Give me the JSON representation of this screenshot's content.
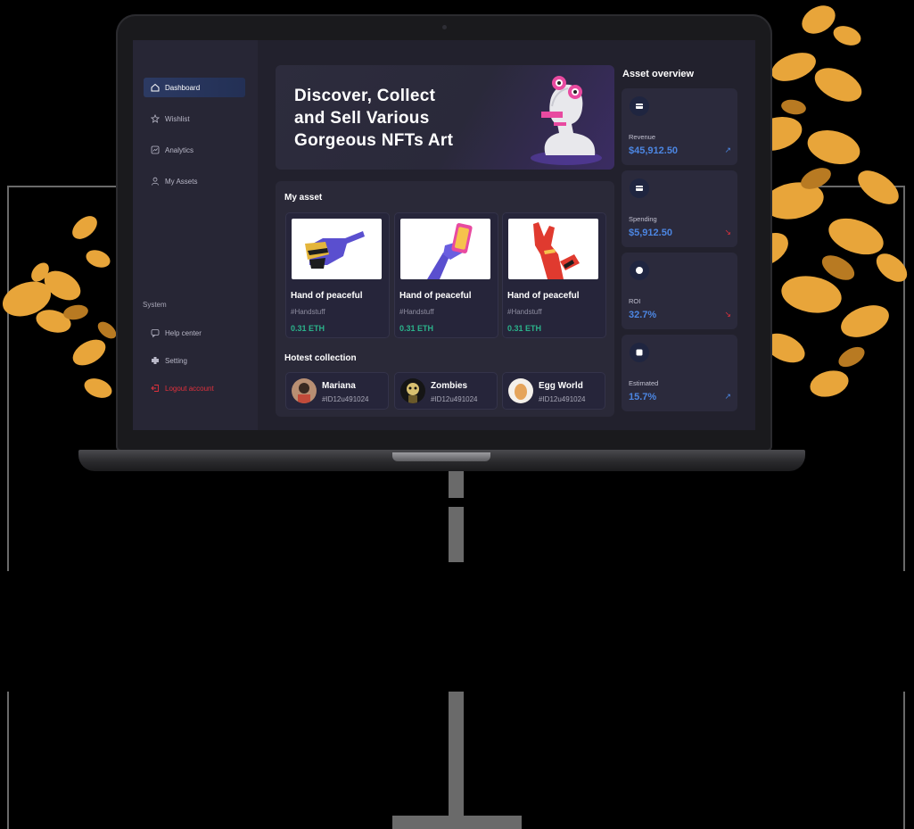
{
  "sidebar": {
    "items": [
      {
        "label": "Dashboard",
        "icon": "home-icon",
        "active": true
      },
      {
        "label": "Wishlist",
        "icon": "star-icon"
      },
      {
        "label": "Analytics",
        "icon": "chart-icon"
      },
      {
        "label": "My Assets",
        "icon": "user-icon"
      }
    ],
    "system_label": "System",
    "system_items": [
      {
        "label": "Help center",
        "icon": "chat-icon"
      },
      {
        "label": "Setting",
        "icon": "gear-icon"
      },
      {
        "label": "Logout account",
        "icon": "logout-icon"
      }
    ]
  },
  "hero": {
    "title_line1": "Discover, Collect",
    "title_line2": "and Sell Various",
    "title_line3": "Gorgeous NFTs Art"
  },
  "my_asset": {
    "title": "My asset",
    "items": [
      {
        "name": "Hand of peaceful",
        "tag": "#Handstuff",
        "price": "0.31 ETH",
        "art": "yellow-black-hand"
      },
      {
        "name": "Hand of peaceful",
        "tag": "#Handstuff",
        "price": "0.31 ETH",
        "art": "purple-hand-phone"
      },
      {
        "name": "Hand of peaceful",
        "tag": "#Handstuff",
        "price": "0.31 ETH",
        "art": "red-hand-rock"
      }
    ]
  },
  "hotest": {
    "title": "Hotest collection",
    "items": [
      {
        "name": "Mariana",
        "id": "#ID12u491024"
      },
      {
        "name": "Zombies",
        "id": "#ID12u491024"
      },
      {
        "name": "Egg World",
        "id": "#ID12u491024"
      }
    ]
  },
  "overview": {
    "title": "Asset overview",
    "stats": [
      {
        "label": "Revenue",
        "value": "$45,912.50",
        "trend": "up",
        "trend_color": "#4c86e2"
      },
      {
        "label": "Spending",
        "value": "$5,912.50",
        "trend": "down",
        "trend_color": "#e0313c"
      },
      {
        "label": "ROI",
        "value": "32.7%",
        "trend": "down",
        "trend_color": "#e0313c"
      },
      {
        "label": "Estimated",
        "value": "15.7%",
        "trend": "up",
        "trend_color": "#4c86e2"
      }
    ]
  },
  "colors": {
    "accent": "#4c86e2",
    "price": "#2bb38b",
    "logout": "#e0313c",
    "plant": "#e8a53a"
  }
}
